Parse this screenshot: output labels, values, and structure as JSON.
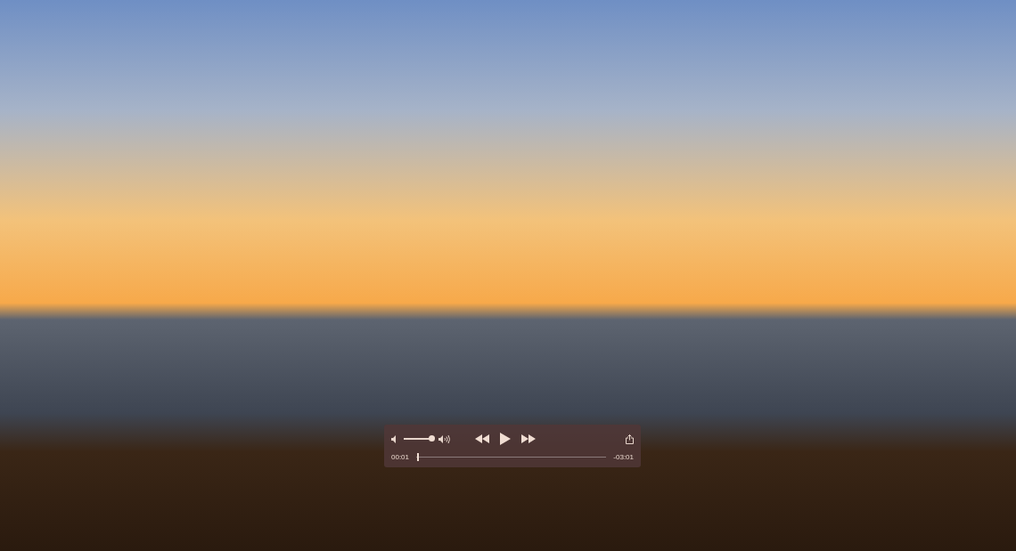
{
  "player": {
    "playing": false,
    "volume": {
      "level": 0.95
    },
    "progress": {
      "level": 0.01
    },
    "elapsed": "00:01",
    "remaining": "-03:01"
  }
}
